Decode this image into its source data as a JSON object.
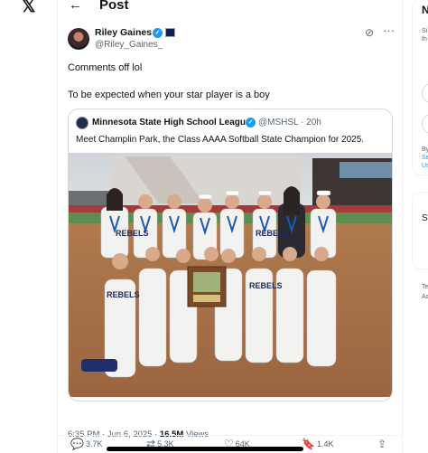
{
  "nav": {
    "logo_icon": "x-logo-icon"
  },
  "header": {
    "title": "Post",
    "back_icon": "back-arrow-icon"
  },
  "post": {
    "author": {
      "name": "Riley Gaines",
      "handle": "@Riley_Gaines_",
      "verified": true
    },
    "text_lines": [
      "Comments off lol",
      "To be expected when your star player is a boy"
    ],
    "quoted": {
      "author_name": "Minnesota State High School League",
      "handle": "@MSHSL",
      "separator": "·",
      "time": "20h",
      "text": "Meet Champlin Park, the Class AAAA Softball State Champion for 2025.",
      "jersey_text": "REBELS"
    },
    "timestamp": "6:35 PM · Jun 6, 2025 ·",
    "views_count": "16.5M",
    "views_label": "Views",
    "actions": {
      "replies": "3.7K",
      "reposts": "5.3K",
      "likes": "64K",
      "bookmarks": "1.4K"
    }
  },
  "sidebar_right": {
    "title_fragment": "N",
    "lines_top": [
      "Si",
      "th"
    ],
    "lines_mid": [
      "By",
      "Se",
      "Us"
    ],
    "lines_bottom_title": "S",
    "lines_bottom": [
      "Te",
      "Ac"
    ],
    "link_color": "#1d9bf0"
  },
  "colors": {
    "accent": "#1d9bf0",
    "text": "#0f1419",
    "muted": "#536471"
  }
}
